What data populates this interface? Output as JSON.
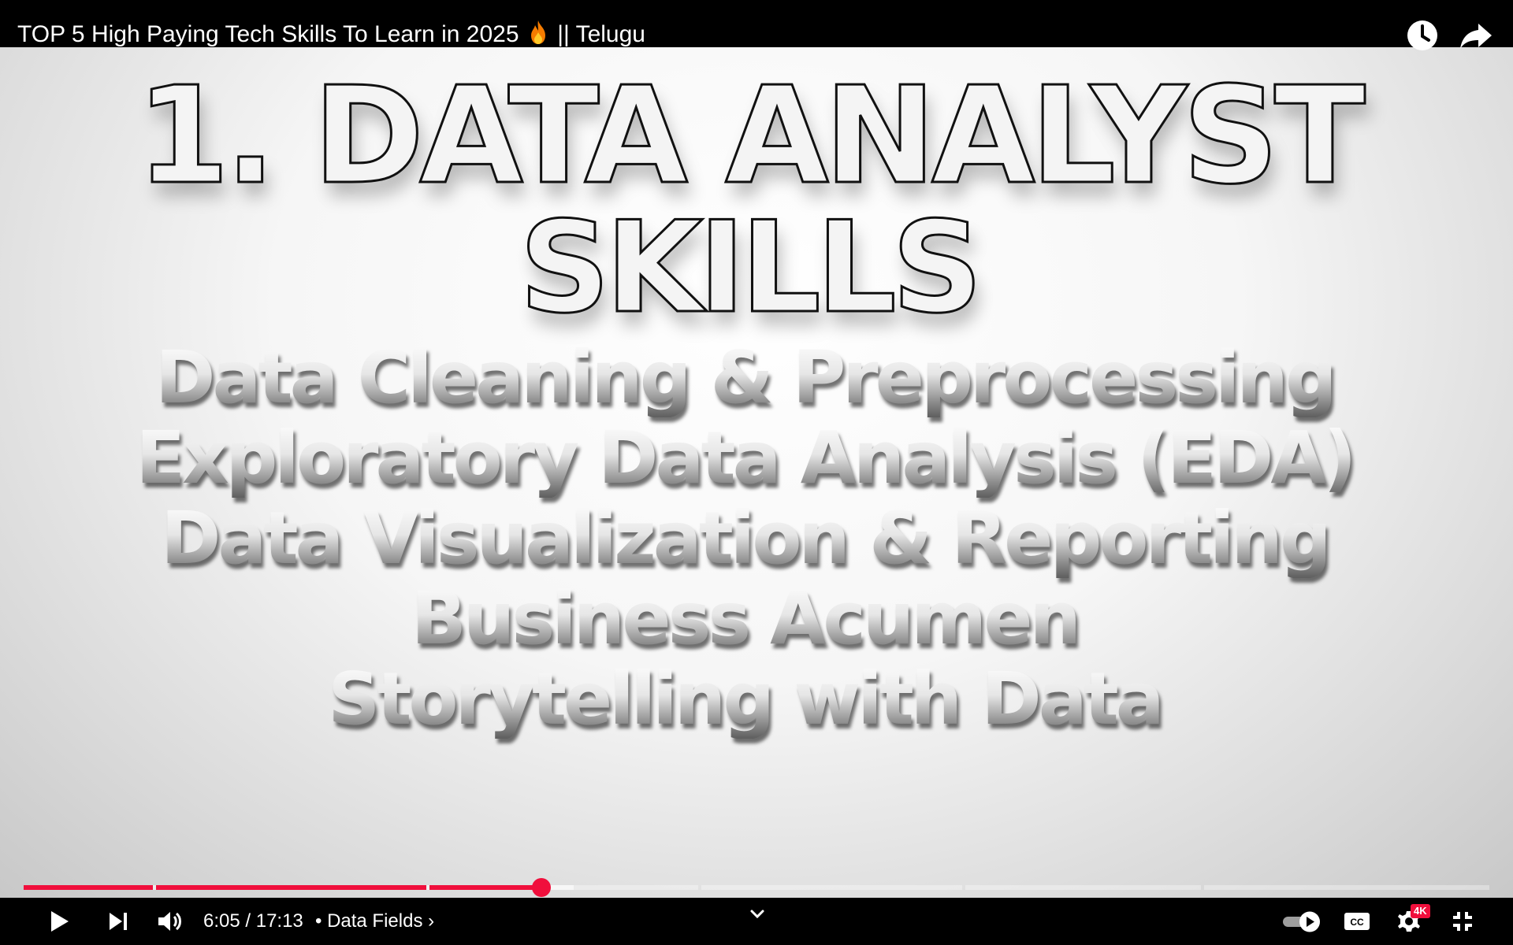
{
  "header": {
    "title_before_emoji": "TOP 5 High Paying Tech Skills To Learn in 2025",
    "title_emoji": "fire-emoji",
    "title_after_emoji": "|| Telugu",
    "icons": [
      "watch-later-icon",
      "share-icon"
    ]
  },
  "video": {
    "heading_line1": "1. DATA ANALYST",
    "heading_line2": "SKILLS",
    "skills": [
      "Data Cleaning & Preprocessing",
      "Exploratory Data Analysis (EDA)",
      "Data Visualization & Reporting",
      "Business Acumen",
      "Storytelling with Data"
    ]
  },
  "player": {
    "current_time": "6:05",
    "duration": "17:13",
    "time_display": "6:05 / 17:13",
    "chapter_label": "• Data Fields ›",
    "progress_fraction": 0.353,
    "buffered_fraction": 0.375,
    "quality_badge": "4K",
    "accent_color": "#f00f3c",
    "icons": [
      "play-icon",
      "next-icon",
      "volume-icon",
      "chevron-down-icon",
      "autoplay-toggle-icon",
      "captions-icon",
      "settings-icon",
      "exit-fullscreen-icon"
    ]
  }
}
